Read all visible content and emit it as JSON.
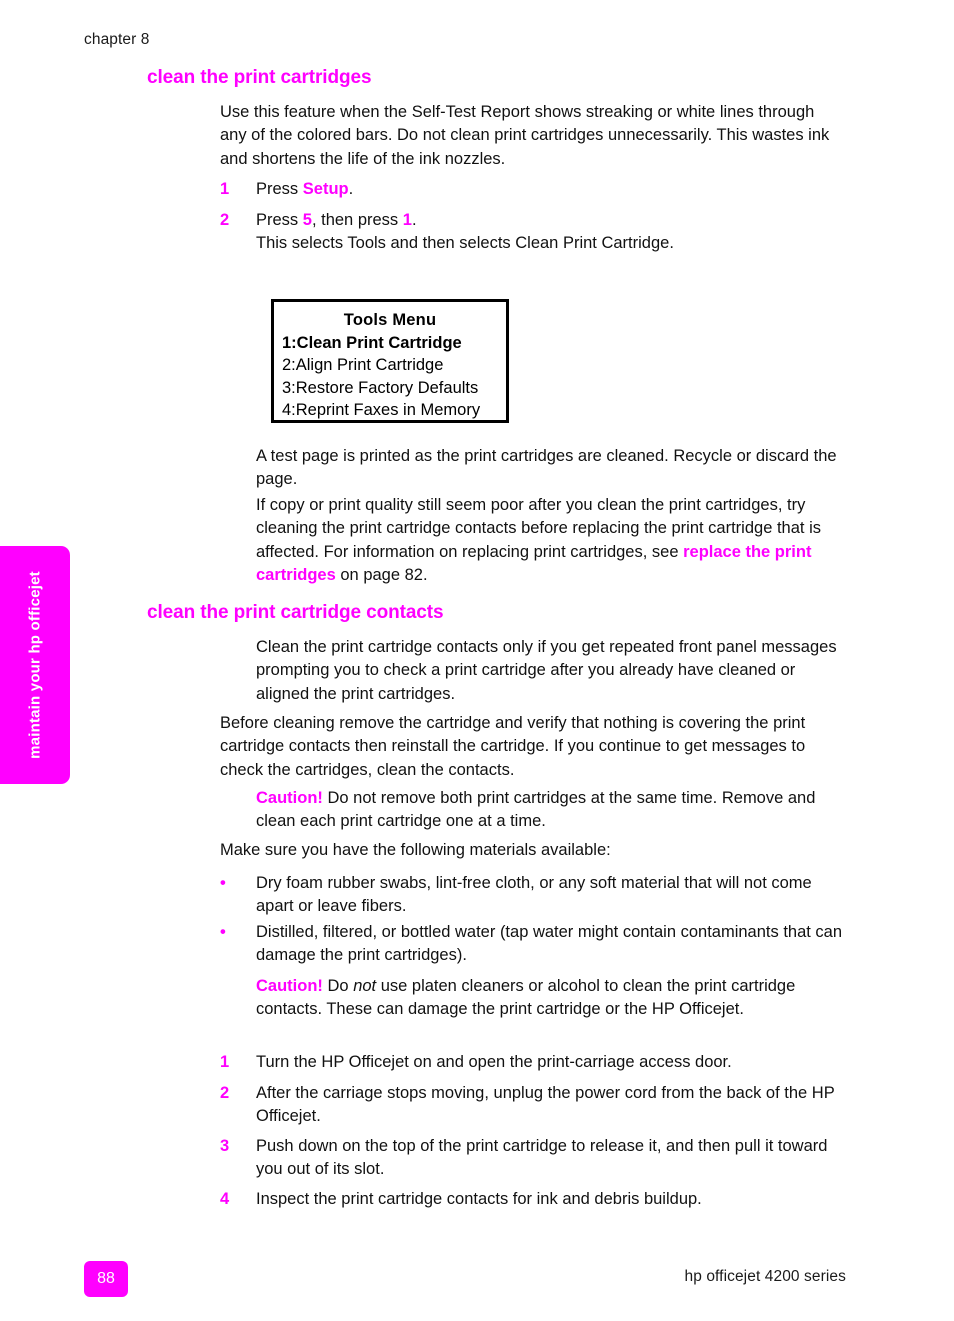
{
  "header": {
    "chapter": "chapter 8"
  },
  "side_tab": {
    "label": "maintain your hp officejet",
    "color": "#ff00ff"
  },
  "accent_color": "#ff00ff",
  "sections": [
    {
      "heading": "clean the print cartridges",
      "intro": "Use this feature when the Self-Test Report shows streaking or white lines through any of the colored bars. Do not clean print cartridges unnecessarily. This wastes ink and shortens the life of the ink nozzles.",
      "steps": [
        {
          "number": "1",
          "text_before": "Press ",
          "emphasis": "Setup",
          "text_after": "."
        },
        {
          "number": "2",
          "line1_a": "Press ",
          "line1_key1": "5",
          "line1_b": ", then press ",
          "line1_key2": "1",
          "line1_c": ".",
          "line2": "This selects Tools and then selects Clean Print Cartridge."
        }
      ],
      "after_paragraphs": {
        "p1": "A test page is printed as the print cartridges are cleaned. Recycle or discard the page.",
        "p2_a": "If copy or print quality still seem poor after you clean the print cartridges, try cleaning the print cartridge contacts before replacing the print cartridge that is affected. For information on replacing print cartridges, see ",
        "p2_link": "replace the print cartridges",
        "p2_b": " on page 82."
      }
    },
    {
      "heading": "clean the print cartridge contacts",
      "p1": "Clean the print cartridge contacts only if you get repeated front panel messages prompting you to check a print cartridge after you already have cleaned or aligned the print cartridges.",
      "p2": "Before cleaning remove the cartridge and verify that nothing is covering the print cartridge contacts then reinstall the cartridge. If you continue to get messages to check the cartridges, clean the contacts.",
      "caution1": {
        "label": "Caution!",
        "text": "Do not remove both print cartridges at the same time. Remove and clean each print cartridge one at a time."
      },
      "materials_intro": "Make sure you have the following materials available:",
      "bullet_marker": "•",
      "bullets": [
        "Dry foam rubber swabs, lint-free cloth, or any soft material that will not come apart or leave fibers.",
        "Distilled, filtered, or bottled water (tap water might contain contaminants that can damage the print cartridges)."
      ],
      "caution2": {
        "label": "Caution!",
        "text_a": "Do ",
        "text_italic": "not",
        "text_b": " use platen cleaners or alcohol to clean the print cartridge contacts. These can damage the print cartridge or the HP Officejet."
      },
      "steps": [
        {
          "number": "1",
          "text": "Turn the HP Officejet on and open the print-carriage access door."
        },
        {
          "number": "2",
          "text": "After the carriage stops moving, unplug the power cord from the back of the HP Officejet."
        },
        {
          "number": "3",
          "text": "Push down on the top of the print cartridge to release it, and then pull it toward you out of its slot."
        },
        {
          "number": "4",
          "text": "Inspect the print cartridge contacts for ink and debris buildup."
        }
      ]
    }
  ],
  "tools_menu": {
    "title": "Tools Menu",
    "items": [
      {
        "label": "1:Clean Print Cartridge",
        "selected": true
      },
      {
        "label": "2:Align Print Cartridge",
        "selected": false
      },
      {
        "label": "3:Restore Factory Defaults",
        "selected": false
      },
      {
        "label": "4:Reprint Faxes in Memory",
        "selected": false
      }
    ]
  },
  "footer": {
    "page_number": "88",
    "product": "hp officejet 4200 series"
  }
}
